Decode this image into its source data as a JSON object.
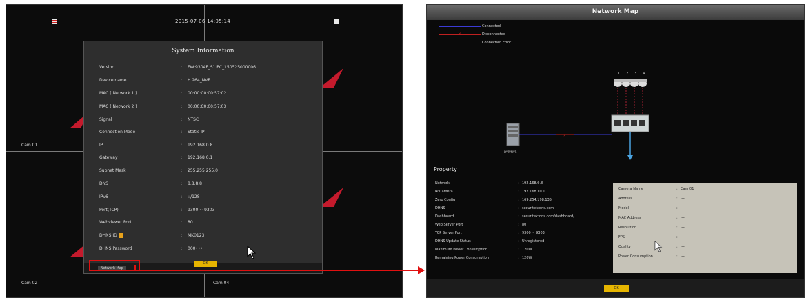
{
  "left_screen": {
    "datetime": "2015-07-06 14:05:14",
    "cameras": [
      "Cam 01",
      "Cam 02",
      "Cam 04"
    ],
    "system_info": {
      "title": "System Information",
      "rows": [
        {
          "label": "Version",
          "value": "FW:9304F_S1.PC_150525000006"
        },
        {
          "label": "Device name",
          "value": "H.264_NVR"
        },
        {
          "label": "MAC ( Network 1 )",
          "value": "00:00:C0:00:57:02"
        },
        {
          "label": "MAC ( Network 2 )",
          "value": "00:00:C0:00:57:03"
        },
        {
          "label": "Signal",
          "value": "NTSC"
        },
        {
          "label": "Connection Mode",
          "value": "Static IP"
        },
        {
          "label": "IP",
          "value": "192.168.0.8"
        },
        {
          "label": "Gateway",
          "value": "192.168.0.1"
        },
        {
          "label": "Subnet Mask",
          "value": "255.255.255.0"
        },
        {
          "label": "DNS",
          "value": "8.8.8.8"
        },
        {
          "label": "IPv6",
          "value": "::/128"
        },
        {
          "label": "Port(TCP)",
          "value": "9300 ~ 9303"
        },
        {
          "label": "Webviewer Port",
          "value": "80"
        },
        {
          "label": "DHNS ID",
          "value": "MK0123"
        },
        {
          "label": "DHNS Password",
          "value": "000•••"
        }
      ],
      "network_map_button": "Network Map",
      "ok_button": "OK"
    }
  },
  "right_screen": {
    "title": "Network Map",
    "legend": [
      {
        "label": "Connected",
        "color": "#3b3bd6"
      },
      {
        "label": "Disconnected",
        "color": "#c02020"
      },
      {
        "label": "Connection Error",
        "color": "#c02020"
      }
    ],
    "dvr_label": "DVR/NVR",
    "port_numbers": [
      "1",
      "2",
      "3",
      "4"
    ],
    "property": {
      "heading": "Property",
      "rows": [
        {
          "label": "Network",
          "value": "192.168.0.8"
        },
        {
          "label": "IP Camera",
          "value": "192.168.30.1"
        },
        {
          "label": "Zero Config",
          "value": "169.254.198.135"
        },
        {
          "label": "DHNS",
          "value": "securitektdns.com"
        },
        {
          "label": "Dashboard",
          "value": "securitektdns.com/dashboard/"
        },
        {
          "label": "Web Server Port",
          "value": "80"
        },
        {
          "label": "TCP Server Port",
          "value": "9300 ~ 9303"
        },
        {
          "label": "DHNS Update Status",
          "value": "Unregistered"
        },
        {
          "label": "Maximum Power Consumption",
          "value": "120W"
        },
        {
          "label": "Remaining Power Consumption",
          "value": "120W"
        }
      ]
    },
    "camera_panel": {
      "rows": [
        {
          "label": "Camera Name",
          "value": "Cam 01"
        },
        {
          "label": "Address",
          "value": "----"
        },
        {
          "label": "Model",
          "value": "----"
        },
        {
          "label": "MAC Address",
          "value": "----"
        },
        {
          "label": "Resolution",
          "value": "----"
        },
        {
          "label": "FPS",
          "value": "----"
        },
        {
          "label": "Quality",
          "value": "----"
        },
        {
          "label": "Power Consumption",
          "value": "----"
        }
      ]
    },
    "ok_button": "OK"
  },
  "colors": {
    "highlight": "#e01010",
    "ok_button": "#e6b500",
    "panel_bg": "#2e2e2e",
    "camera_panel_bg": "#c6c3b8"
  }
}
